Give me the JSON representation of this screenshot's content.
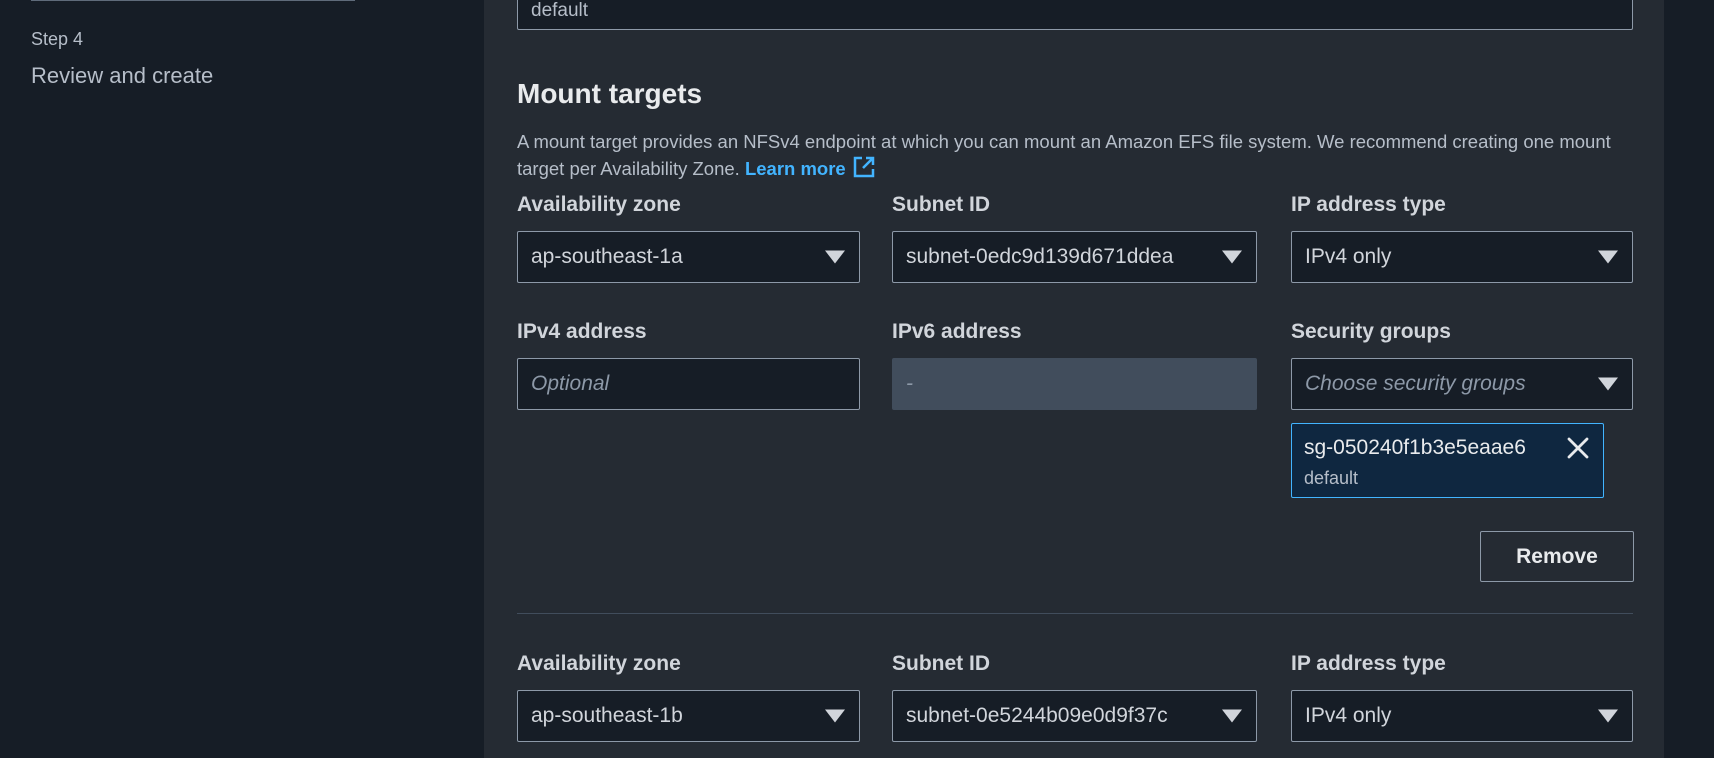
{
  "sidebar": {
    "step_label": "Step 4",
    "step_title": "Review and create"
  },
  "previous_field": {
    "value": "default"
  },
  "mount_targets": {
    "title": "Mount targets",
    "description": "A mount target provides an NFSv4 endpoint at which you can mount an Amazon EFS file system. We recommend creating one mount target per Availability Zone.",
    "learn_more": "Learn more",
    "labels": {
      "availability_zone": "Availability zone",
      "subnet_id": "Subnet ID",
      "ip_address_type": "IP address type",
      "ipv4_address": "IPv4 address",
      "ipv6_address": "IPv6 address",
      "security_groups": "Security groups"
    },
    "targets": [
      {
        "availability_zone": "ap-southeast-1a",
        "subnet_id": "subnet-0edc9d139d671ddea",
        "ip_address_type": "IPv4 only",
        "ipv4_placeholder": "Optional",
        "ipv6_value": "-",
        "security_groups_placeholder": "Choose security groups",
        "security_group_token": {
          "id": "sg-050240f1b3e5eaae6",
          "name": "default"
        },
        "remove_label": "Remove"
      },
      {
        "availability_zone": "ap-southeast-1b",
        "subnet_id": "subnet-0e5244b09e0d9f37c",
        "ip_address_type": "IPv4 only"
      }
    ]
  },
  "colors": {
    "link": "#42b4ff",
    "page_background": "#161d26",
    "panel_background": "#252b33"
  }
}
